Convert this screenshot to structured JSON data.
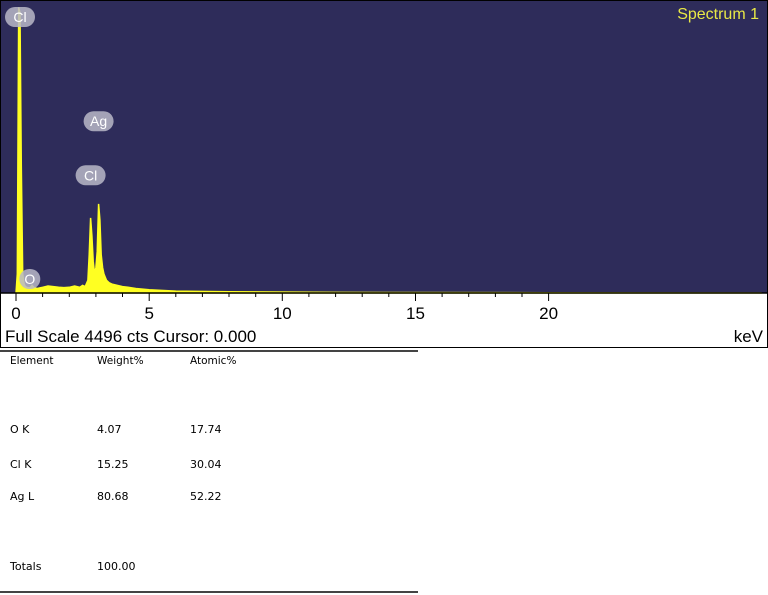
{
  "chart_data": {
    "type": "area",
    "title": "Spectrum 1",
    "xlabel": "keV",
    "xlim": [
      0,
      28.2
    ],
    "ylim": [
      0,
      4496
    ],
    "xticks": [
      0,
      5,
      10,
      15,
      20
    ],
    "grid": false,
    "colors": {
      "plot_bg": "#2e2c5a",
      "trace": "#ffff22",
      "title": "#e8e846",
      "peak_label_fill": "#b8b8c8",
      "peak_label_text": "#ffffff"
    },
    "series": [
      {
        "x": [
          0.0,
          0.05,
          0.1,
          0.15,
          0.2,
          0.25,
          0.3,
          0.35,
          0.4,
          0.45,
          0.5,
          0.55,
          0.6,
          0.7,
          0.8,
          0.9,
          1.0,
          1.2,
          1.4,
          1.6,
          1.8,
          2.0,
          2.2,
          2.4,
          2.5,
          2.6,
          2.7,
          2.75,
          2.8,
          2.85,
          2.9,
          2.95,
          3.0,
          3.05,
          3.1,
          3.15,
          3.2,
          3.25,
          3.3,
          3.35,
          3.4,
          3.5,
          3.6,
          3.8,
          4.0,
          4.2,
          4.5,
          5.0,
          6.0,
          8.0,
          12.0,
          20.0,
          28.0
        ],
        "y": [
          0,
          300,
          4490,
          4400,
          2000,
          300,
          150,
          100,
          90,
          85,
          80,
          90,
          120,
          80,
          70,
          80,
          90,
          110,
          100,
          90,
          85,
          90,
          110,
          90,
          120,
          100,
          200,
          600,
          1180,
          900,
          500,
          300,
          400,
          650,
          1400,
          1150,
          600,
          400,
          300,
          250,
          200,
          160,
          140,
          120,
          100,
          90,
          70,
          50,
          30,
          20,
          10,
          5,
          0
        ]
      }
    ],
    "peaks": [
      {
        "label": "Cl",
        "x": 0.15,
        "y": 4496
      },
      {
        "label": "O",
        "x": 0.52,
        "y": 220
      },
      {
        "label": "Cl",
        "x": 2.8,
        "y": 1850
      },
      {
        "label": "Ag",
        "x": 3.1,
        "y": 2700
      }
    ]
  },
  "status": {
    "full_scale": "Full Scale 4496 cts Cursor: 0.000",
    "unit": "keV"
  },
  "table": {
    "headers": [
      "Element",
      "Weight%",
      "Atomic%"
    ],
    "rows": [
      [
        "O K",
        "4.07",
        "17.74"
      ],
      [
        "Cl K",
        "15.25",
        "30.04"
      ],
      [
        "Ag L",
        "80.68",
        "52.22"
      ]
    ],
    "totals": [
      "Totals",
      "100.00"
    ]
  }
}
